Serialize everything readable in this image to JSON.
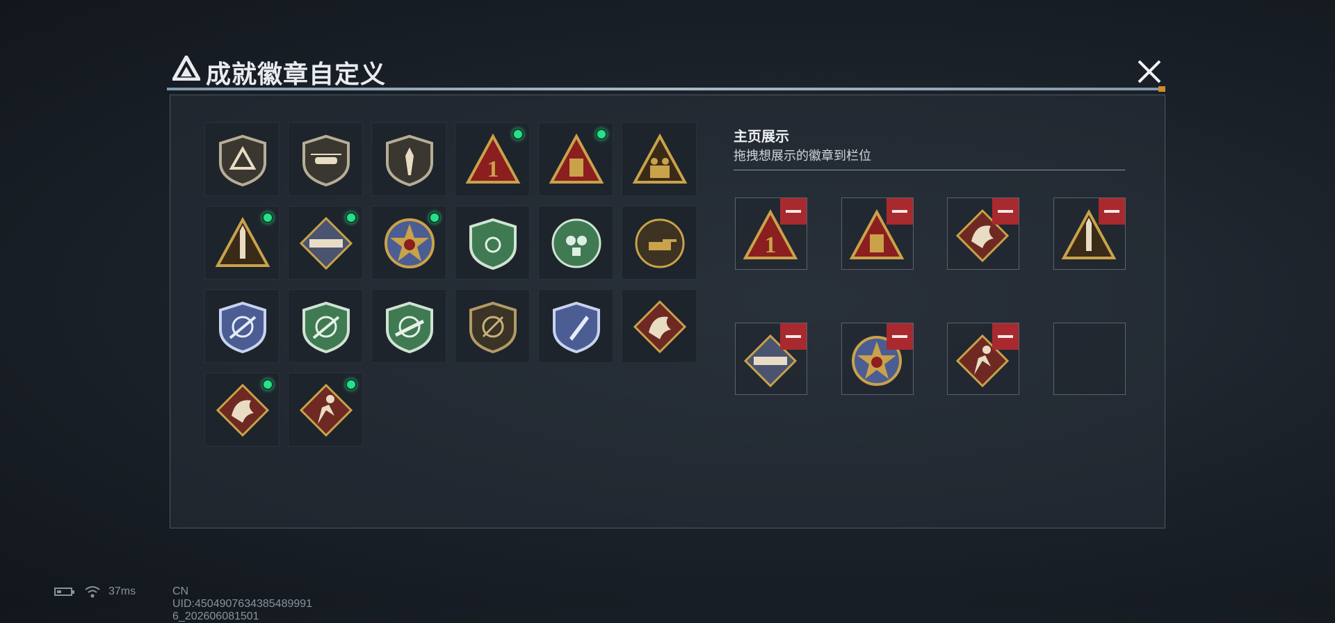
{
  "header": {
    "title": "成就徽章自定义",
    "close_icon": "close-icon"
  },
  "side": {
    "title": "主页展示",
    "subtitle": "拖拽想展示的徽章到栏位"
  },
  "badges": [
    {
      "icon": "shield-logo-icon",
      "new": false
    },
    {
      "icon": "helicopter-shield-icon",
      "new": false
    },
    {
      "icon": "dagger-shield-icon",
      "new": false
    },
    {
      "icon": "triangle-number-one-icon",
      "new": true
    },
    {
      "icon": "triangle-supply-crate-icon",
      "new": true
    },
    {
      "icon": "triangle-soldiers-icon",
      "new": false
    },
    {
      "icon": "triangle-missile-icon",
      "new": true
    },
    {
      "icon": "diamond-rocket-launcher-icon",
      "new": true
    },
    {
      "icon": "star-medal-icon",
      "new": true
    },
    {
      "icon": "green-shield-crest-icon",
      "new": false
    },
    {
      "icon": "green-gasmask-emblem-icon",
      "new": false
    },
    {
      "icon": "gold-tank-emblem-icon",
      "new": false
    },
    {
      "icon": "blue-sniper-crest-icon",
      "new": false
    },
    {
      "icon": "green-rifle-crest-icon",
      "new": false
    },
    {
      "icon": "green-assault-rifle-crest-icon",
      "new": false
    },
    {
      "icon": "bronze-crosshair-shield-icon",
      "new": false
    },
    {
      "icon": "blue-knife-crest-icon",
      "new": false
    },
    {
      "icon": "dragon-diamond-icon",
      "new": false
    },
    {
      "icon": "dragon-diamond-icon",
      "new": true
    },
    {
      "icon": "runner-diamond-icon",
      "new": true
    }
  ],
  "slots": [
    {
      "icon": "triangle-number-one-icon",
      "filled": true
    },
    {
      "icon": "triangle-supply-crate-icon",
      "filled": true
    },
    {
      "icon": "dragon-diamond-icon",
      "filled": true
    },
    {
      "icon": "triangle-missile-icon",
      "filled": true
    },
    {
      "icon": "diamond-rocket-launcher-icon",
      "filled": true
    },
    {
      "icon": "star-medal-icon",
      "filled": true
    },
    {
      "icon": "runner-diamond-icon",
      "filled": true
    },
    {
      "icon": "empty-slot",
      "filled": false
    }
  ],
  "status": {
    "ping": "37ms",
    "uid": "CN UID:4504907634385489991​6_202606081501"
  }
}
